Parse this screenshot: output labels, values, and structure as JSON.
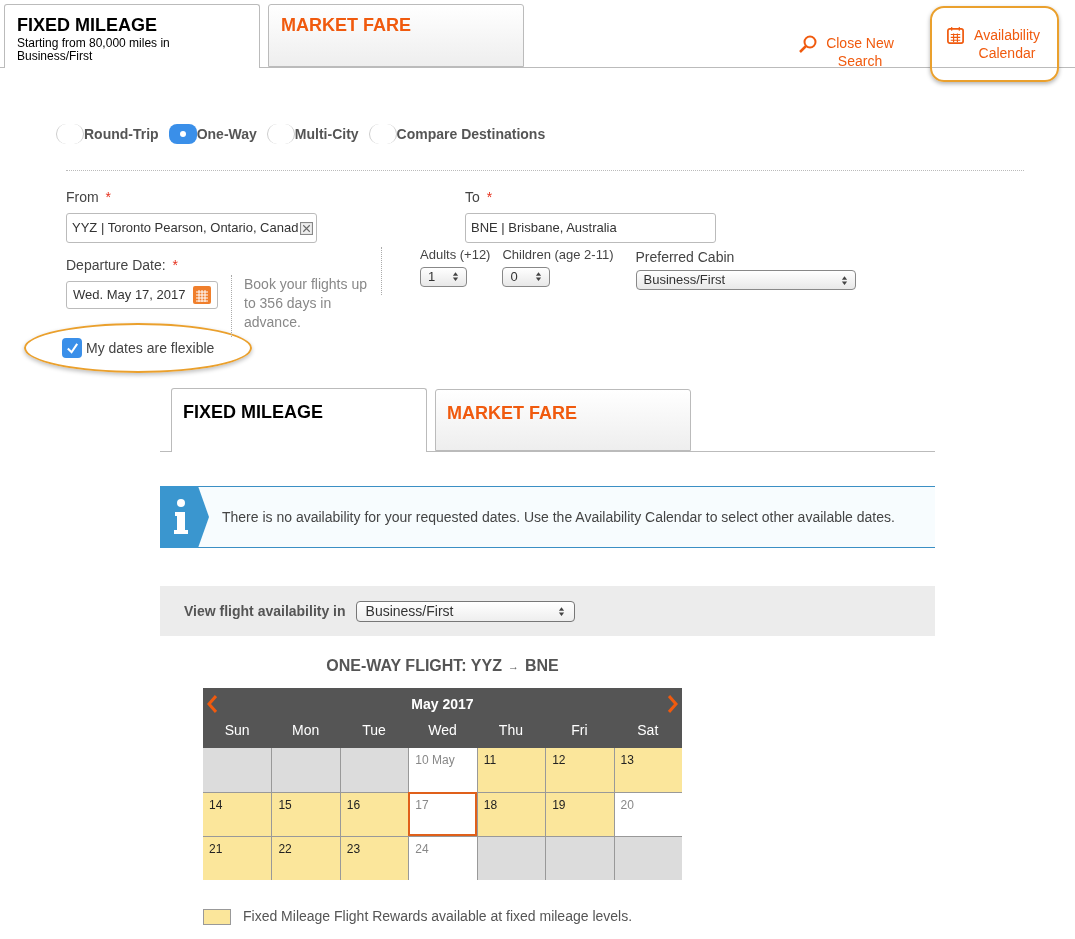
{
  "top_tabs": [
    {
      "label": "FIXED MILEAGE",
      "subtitle": "Starting from  80,000 miles in Business/First",
      "selected": true
    },
    {
      "label": "MARKET FARE",
      "selected": false
    }
  ],
  "header_links": [
    {
      "kind": "search",
      "label": "Close New Search",
      "highlighted": false
    },
    {
      "kind": "calendar",
      "label": "Availability Calendar",
      "highlighted": true
    }
  ],
  "trip_types": [
    {
      "label": "Round-Trip",
      "selected": false
    },
    {
      "label": "One-Way",
      "selected": true
    },
    {
      "label": "Multi-City",
      "selected": false
    },
    {
      "label": "Compare Destinations",
      "selected": false
    }
  ],
  "from": {
    "label": "From",
    "required": "*",
    "value": "YYZ | Toronto Pearson, Ontario, Canad"
  },
  "to": {
    "label": "To",
    "required": "*",
    "value": "BNE | Brisbane, Australia"
  },
  "departure": {
    "label": "Departure Date:",
    "required": "*",
    "value": "Wed. May 17, 2017"
  },
  "booking_note": "Book your flights up to 356 days in advance.",
  "adults": {
    "label": "Adults (+12)",
    "value": "1"
  },
  "children": {
    "label": "Children (age 2-11)",
    "value": "0"
  },
  "cabin": {
    "label": "Preferred Cabin",
    "value": "Business/First"
  },
  "flexible": {
    "label": "My dates are flexible",
    "checked": true,
    "highlighted": true
  },
  "result_tabs": [
    {
      "label": "FIXED MILEAGE",
      "selected": true
    },
    {
      "label": "MARKET FARE",
      "selected": false
    }
  ],
  "notice": "There is no availability for your requested dates. Use the Availability Calendar to select other available dates.",
  "view_in": {
    "label": "View flight availability in",
    "value": "Business/First"
  },
  "flight_title": {
    "prefix": "ONE-WAY FLIGHT:  YYZ",
    "arrow": "→",
    "suffix": "BNE"
  },
  "calendar": {
    "month": "May 2017",
    "weekdays": [
      "Sun",
      "Mon",
      "Tue",
      "Wed",
      "Thu",
      "Fri",
      "Sat"
    ],
    "weeks": [
      [
        {
          "kind": "empty"
        },
        {
          "kind": "empty"
        },
        {
          "kind": "empty"
        },
        {
          "kind": "unavailable",
          "day": "10 May",
          "selected": false
        },
        {
          "kind": "available",
          "day": "11",
          "selected": false
        },
        {
          "kind": "available",
          "day": "12",
          "selected": false
        },
        {
          "kind": "available",
          "day": "13",
          "selected": false
        }
      ],
      [
        {
          "kind": "available",
          "day": "14",
          "selected": false
        },
        {
          "kind": "available",
          "day": "15",
          "selected": false
        },
        {
          "kind": "available",
          "day": "16",
          "selected": false
        },
        {
          "kind": "unavailable",
          "day": "17",
          "selected": true
        },
        {
          "kind": "available",
          "day": "18",
          "selected": false
        },
        {
          "kind": "available",
          "day": "19",
          "selected": false
        },
        {
          "kind": "unavailable",
          "day": "20",
          "selected": false
        }
      ],
      [
        {
          "kind": "available",
          "day": "21",
          "selected": false
        },
        {
          "kind": "available",
          "day": "22",
          "selected": false
        },
        {
          "kind": "available",
          "day": "23",
          "selected": false
        },
        {
          "kind": "unavailable",
          "day": "24",
          "selected": false
        },
        {
          "kind": "empty"
        },
        {
          "kind": "empty"
        },
        {
          "kind": "empty"
        }
      ]
    ]
  },
  "legend": "Fixed Mileage Flight Rewards available at fixed mileage levels."
}
